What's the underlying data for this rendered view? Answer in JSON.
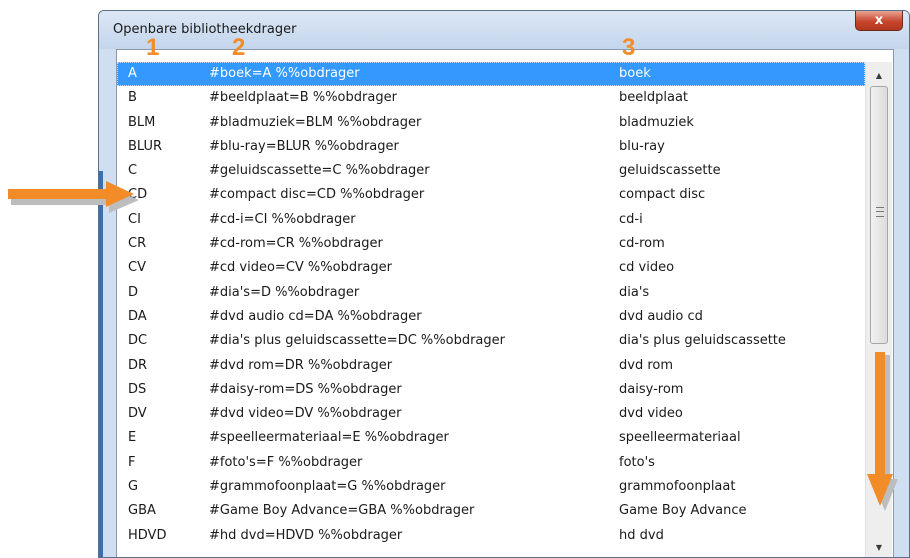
{
  "window": {
    "title": "Openbare bibliotheekdrager",
    "close_glyph": "x"
  },
  "annotations": {
    "markers": [
      "1",
      "2",
      "3"
    ],
    "arrow_color": "#f28c28"
  },
  "colors": {
    "selection": "#3399ff",
    "frame": "#cfdff1"
  },
  "list": {
    "selected_index": 0,
    "rows": [
      {
        "code": "A",
        "expr": "#boek=A %%obdrager",
        "desc": "boek"
      },
      {
        "code": "B",
        "expr": "#beeldplaat=B %%obdrager",
        "desc": "beeldplaat"
      },
      {
        "code": "BLM",
        "expr": "#bladmuziek=BLM %%obdrager",
        "desc": "bladmuziek"
      },
      {
        "code": "BLUR",
        "expr": "#blu-ray=BLUR %%obdrager",
        "desc": "blu-ray"
      },
      {
        "code": "C",
        "expr": "#geluidscassette=C %%obdrager",
        "desc": "geluidscassette"
      },
      {
        "code": "CD",
        "expr": "#compact disc=CD %%obdrager",
        "desc": "compact disc"
      },
      {
        "code": "CI",
        "expr": "#cd-i=CI %%obdrager",
        "desc": "cd-i"
      },
      {
        "code": "CR",
        "expr": "#cd-rom=CR %%obdrager",
        "desc": "cd-rom"
      },
      {
        "code": "CV",
        "expr": "#cd video=CV %%obdrager",
        "desc": "cd video"
      },
      {
        "code": "D",
        "expr": "#dia's=D %%obdrager",
        "desc": "dia's"
      },
      {
        "code": "DA",
        "expr": "#dvd audio cd=DA %%obdrager",
        "desc": "dvd audio cd"
      },
      {
        "code": "DC",
        "expr": "#dia's plus geluidscassette=DC %%obdrager",
        "desc": "dia's plus geluidscassette"
      },
      {
        "code": "DR",
        "expr": "#dvd rom=DR %%obdrager",
        "desc": "dvd rom"
      },
      {
        "code": "DS",
        "expr": "#daisy-rom=DS %%obdrager",
        "desc": "daisy-rom"
      },
      {
        "code": "DV",
        "expr": "#dvd video=DV %%obdrager",
        "desc": "dvd video"
      },
      {
        "code": "E",
        "expr": "#speelleermateriaal=E %%obdrager",
        "desc": "speelleermateriaal"
      },
      {
        "code": "F",
        "expr": "#foto's=F %%obdrager",
        "desc": "foto's"
      },
      {
        "code": "G",
        "expr": "#grammofoonplaat=G %%obdrager",
        "desc": "grammofoonplaat"
      },
      {
        "code": "GBA",
        "expr": "#Game Boy Advance=GBA %%obdrager",
        "desc": "Game Boy Advance"
      },
      {
        "code": "HDVD",
        "expr": "#hd dvd=HDVD %%obdrager",
        "desc": "hd dvd"
      }
    ]
  },
  "scrollbar": {
    "up_icon": "scroll-up-arrow-icon",
    "down_icon": "scroll-down-arrow-icon"
  }
}
